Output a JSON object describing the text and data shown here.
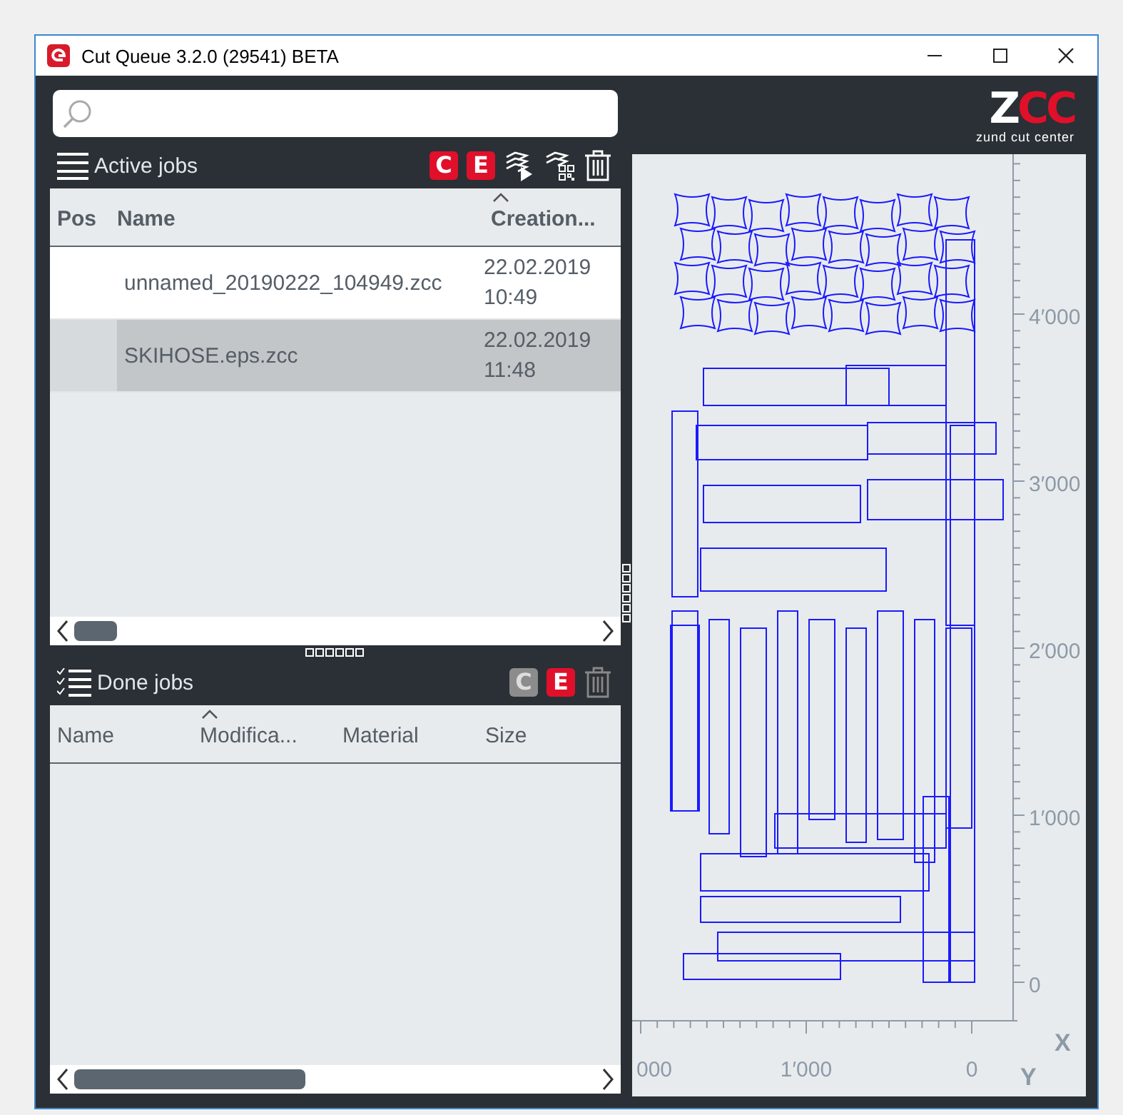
{
  "window": {
    "title": "Cut Queue 3.2.0 (29541) BETA"
  },
  "active_jobs": {
    "title": "Active jobs",
    "tools": [
      {
        "kind": "letter",
        "label": "C",
        "disabled": false
      },
      {
        "kind": "letter",
        "label": "E",
        "disabled": false
      },
      {
        "kind": "send"
      },
      {
        "kind": "qr"
      },
      {
        "kind": "delete"
      }
    ],
    "columns": [
      {
        "label": "Pos",
        "sorted": false
      },
      {
        "label": "Name",
        "sorted": false
      },
      {
        "label": "Creation...",
        "sorted": true
      }
    ],
    "rows": [
      {
        "name": "unnamed_20190222_104949.zcc",
        "date": "22.02.2019",
        "time": "10:49",
        "selected": false
      },
      {
        "name": "SKIHOSE.eps.zcc",
        "date": "22.02.2019",
        "time": "11:48",
        "selected": true
      }
    ]
  },
  "done_jobs": {
    "title": "Done jobs",
    "tools": [
      {
        "kind": "letter",
        "label": "C",
        "disabled": true
      },
      {
        "kind": "letter",
        "label": "E",
        "disabled": false
      },
      {
        "kind": "delete"
      }
    ],
    "columns": [
      {
        "label": "Name",
        "sorted": false
      },
      {
        "label": "Modifica...",
        "sorted": true
      },
      {
        "label": "Material",
        "sorted": false
      },
      {
        "label": "Size",
        "sorted": false
      }
    ]
  },
  "logo": {
    "mark": "ZCC",
    "tagline": "zund cut center"
  },
  "preview": {
    "y_labels": [
      "4′000",
      "3′000",
      "2′000",
      "1′000",
      "0"
    ],
    "x_labels": [
      "000",
      "1′000",
      "0"
    ],
    "x_axis": "X",
    "y_axis": "Y"
  }
}
